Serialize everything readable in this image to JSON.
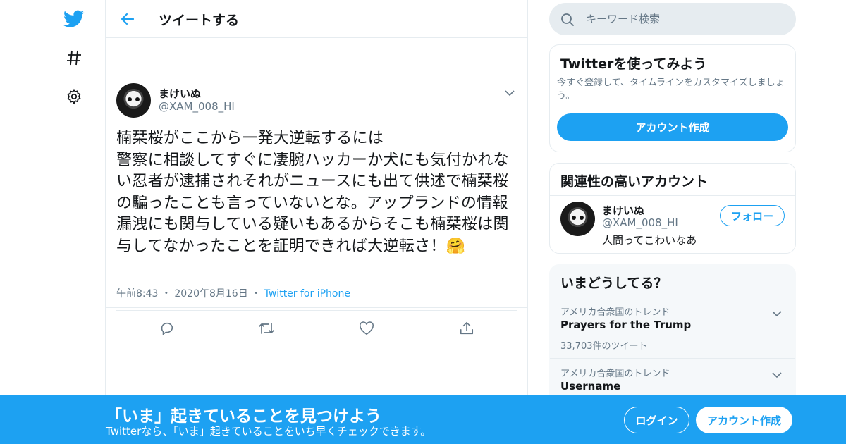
{
  "header": {
    "title": "ツイートする"
  },
  "tweet": {
    "display_name": "まけいぬ",
    "handle": "@XAM_008_HI",
    "text": "楠栞桜がここから一発大逆転するには\n警察に相談してすぐに凄腕ハッカーか犬にも気付かれない忍者が逮捕されそれがニュースにも出て供述で楠栞桜の騙ったことも言っていないとな。アップランドの情報漏洩にも関与している疑いもあるからそこも楠栞桜は関与してなかったことを証明できれば大逆転さ！🤗",
    "time": "午前8:43",
    "date": "2020年8月16日",
    "source": "Twitter for iPhone",
    "separator": "・"
  },
  "search": {
    "placeholder": "キーワード検索"
  },
  "signup_panel": {
    "title": "Twitterを使ってみよう",
    "description": "今すぐ登録して、タイムラインをカスタマイズしましょう。",
    "button": "アカウント作成"
  },
  "related_panel": {
    "title": "関連性の高いアカウント",
    "account": {
      "display_name": "まけいぬ",
      "handle": "@XAM_008_HI",
      "bio": "人間ってこわいなあ",
      "follow_button": "フォロー"
    }
  },
  "trends_panel": {
    "title": "いまどうしてる？",
    "items": [
      {
        "context": "アメリカ合衆国のトレンド",
        "name": "Prayers for the Trump",
        "count": "33,703件のツイート"
      },
      {
        "context": "アメリカ合衆国のトレンド",
        "name": "Username"
      }
    ]
  },
  "banner": {
    "title": "「いま」起きていることを見つけよう",
    "subtitle": "Twitterなら、「いま」起きていることをいち早くチェックできます。",
    "login": "ログイン",
    "signup": "アカウント作成"
  },
  "colors": {
    "accent": "#1da1f2",
    "border": "#e6ecf0",
    "secondary_text": "#657786"
  },
  "icons": [
    "twitter-bird-icon",
    "hashtag-icon",
    "gear-icon",
    "back-arrow-icon",
    "chevron-down-icon",
    "reply-icon",
    "retweet-icon",
    "like-icon",
    "share-icon",
    "search-icon"
  ]
}
